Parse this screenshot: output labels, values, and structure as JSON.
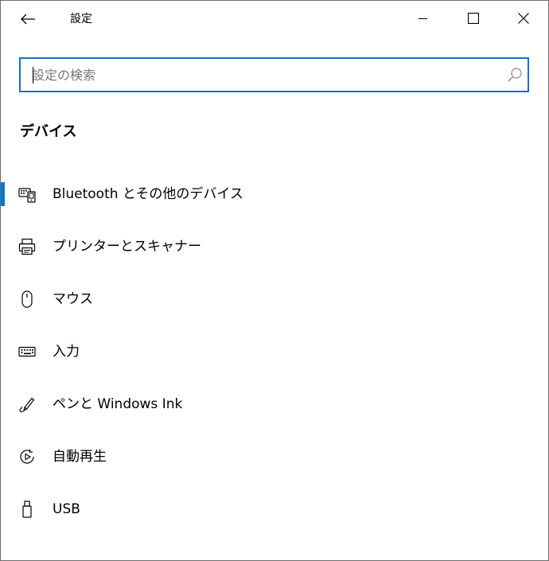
{
  "window": {
    "title": "設定"
  },
  "search": {
    "placeholder": "設定の検索"
  },
  "section": {
    "title": "デバイス"
  },
  "nav": {
    "items": [
      {
        "label": "Bluetooth とその他のデバイス",
        "icon": "bluetooth-devices-icon",
        "selected": true
      },
      {
        "label": "プリンターとスキャナー",
        "icon": "printer-icon",
        "selected": false
      },
      {
        "label": "マウス",
        "icon": "mouse-icon",
        "selected": false
      },
      {
        "label": "入力",
        "icon": "keyboard-icon",
        "selected": false
      },
      {
        "label": "ペンと Windows Ink",
        "icon": "pen-icon",
        "selected": false
      },
      {
        "label": "自動再生",
        "icon": "autoplay-icon",
        "selected": false
      },
      {
        "label": "USB",
        "icon": "usb-icon",
        "selected": false
      }
    ]
  },
  "colors": {
    "accent": "#0078d7",
    "search_border": "#1a6ec7",
    "text": "#000000"
  }
}
